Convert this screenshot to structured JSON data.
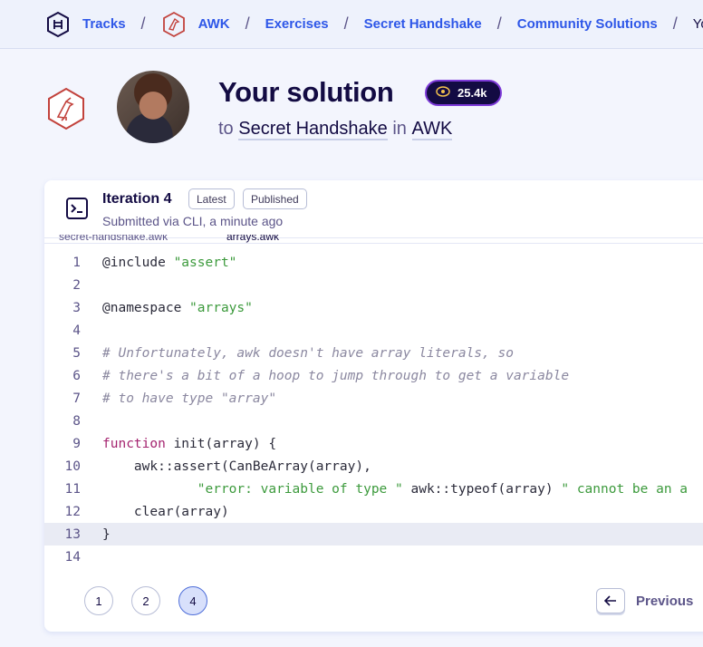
{
  "breadcrumb": {
    "items": [
      "Tracks",
      "AWK",
      "Exercises",
      "Secret Handshake",
      "Community Solutions"
    ],
    "current": "Your solution",
    "separator": "/"
  },
  "header": {
    "title": "Your solution",
    "reputation": "25.4k",
    "to_word": "to",
    "exercise": "Secret Handshake",
    "in_word": "in",
    "track": "AWK"
  },
  "iteration": {
    "title": "Iteration 4",
    "tags": [
      "Latest",
      "Published"
    ],
    "submitted": "Submitted via CLI, a minute ago",
    "files": [
      "secret-handshake.awk",
      "arrays.awk"
    ]
  },
  "code_lines": [
    {
      "n": "1",
      "parts": [
        [
          "",
          "@include "
        ],
        [
          "str",
          "\"assert\""
        ]
      ]
    },
    {
      "n": "2",
      "parts": []
    },
    {
      "n": "3",
      "parts": [
        [
          "",
          "@namespace "
        ],
        [
          "str",
          "\"arrays\""
        ]
      ]
    },
    {
      "n": "4",
      "parts": []
    },
    {
      "n": "5",
      "parts": [
        [
          "cmt",
          "# Unfortunately, awk doesn't have array literals, so"
        ]
      ]
    },
    {
      "n": "6",
      "parts": [
        [
          "cmt",
          "# there's a bit of a hoop to jump through to get a variable"
        ]
      ]
    },
    {
      "n": "7",
      "parts": [
        [
          "cmt",
          "# to have type \"array\""
        ]
      ]
    },
    {
      "n": "8",
      "parts": []
    },
    {
      "n": "9",
      "parts": [
        [
          "kw",
          "function"
        ],
        [
          "",
          " init(array) {"
        ]
      ]
    },
    {
      "n": "10",
      "parts": [
        [
          "",
          "    awk::assert(CanBeArray(array),"
        ]
      ]
    },
    {
      "n": "11",
      "parts": [
        [
          "",
          "            "
        ],
        [
          "str",
          "\"error: variable of type \""
        ],
        [
          "",
          " awk::typeof(array) "
        ],
        [
          "str",
          "\" cannot be an a"
        ]
      ]
    },
    {
      "n": "12",
      "parts": [
        [
          "",
          "    clear(array)"
        ]
      ]
    },
    {
      "n": "13",
      "parts": [
        [
          "",
          "}"
        ]
      ]
    },
    {
      "n": "14",
      "parts": []
    }
  ],
  "highlighted_line": "13",
  "pagination": {
    "pages": [
      "1",
      "2",
      "4"
    ],
    "active": "4",
    "previous_label": "Previous"
  },
  "colors": {
    "accent": "#2e57e8",
    "track_red": "#c2423c",
    "rep_border": "#7d3ad8"
  }
}
